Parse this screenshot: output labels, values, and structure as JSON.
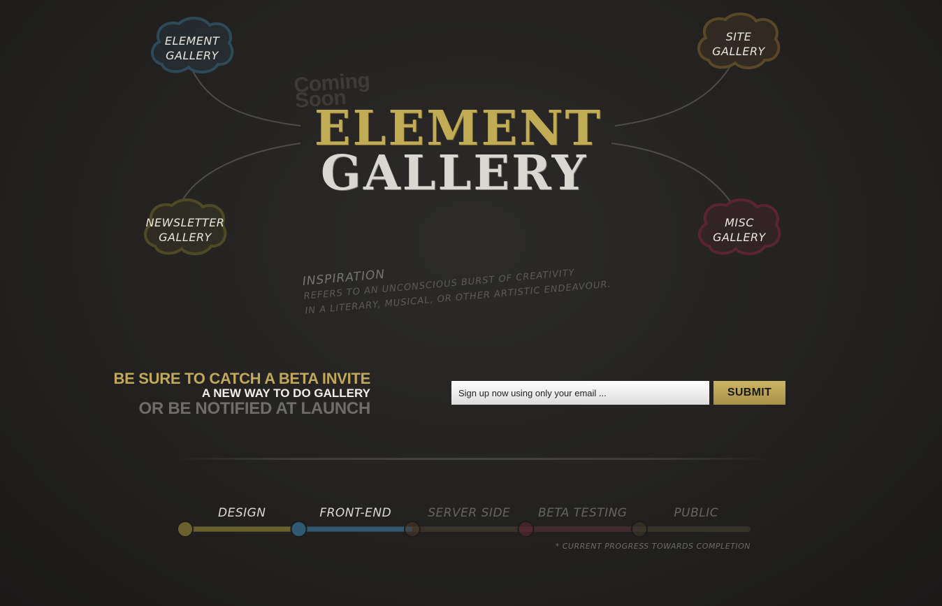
{
  "logo": {
    "coming_soon": "Coming\nSoon",
    "title_line1": "ELEMENT",
    "title_line2": "GALLERY"
  },
  "nav_clouds": [
    {
      "label": "ELEMENT\nGALLERY",
      "color": "#2e4a5a"
    },
    {
      "label": "SITE\nGALLERY",
      "color": "#5a4727"
    },
    {
      "label": "NEWSLETTER\nGALLERY",
      "color": "#4f4a26"
    },
    {
      "label": "MISC\nGALLERY",
      "color": "#5a2433"
    }
  ],
  "quote": {
    "title": "INSPIRATION",
    "line1": "REFERS TO AN UNCONSCIOUS BURST OF CREATIVITY",
    "line2": "IN A LITERARY, MUSICAL, OR OTHER ARTISTIC ENDEAVOUR."
  },
  "beta": {
    "line1": "BE SURE TO CATCH A BETA INVITE",
    "line2": "A NEW WAY TO DO GALLERY",
    "line3": "OR BE NOTIFIED AT LAUNCH"
  },
  "signup": {
    "placeholder": "Sign up now using only your email ...",
    "submit_label": "SUBMIT"
  },
  "progress": {
    "stages": [
      {
        "label": "DESIGN",
        "color": "#6b612f",
        "complete": true
      },
      {
        "label": "FRONT-END",
        "color": "#2f5a72",
        "complete": true
      },
      {
        "label": "SERVER SIDE",
        "color": "#4a3a2c",
        "complete": false
      },
      {
        "label": "BETA TESTING",
        "color": "#5e2437",
        "complete": false
      },
      {
        "label": "PUBLIC",
        "color": "#3e3a2a",
        "complete": false
      }
    ],
    "note": "* CURRENT PROGRESS TOWARDS COMPLETION"
  },
  "colors": {
    "gold": "#c2ab55",
    "chalk": "#d9d7d1",
    "board": "#222120"
  }
}
